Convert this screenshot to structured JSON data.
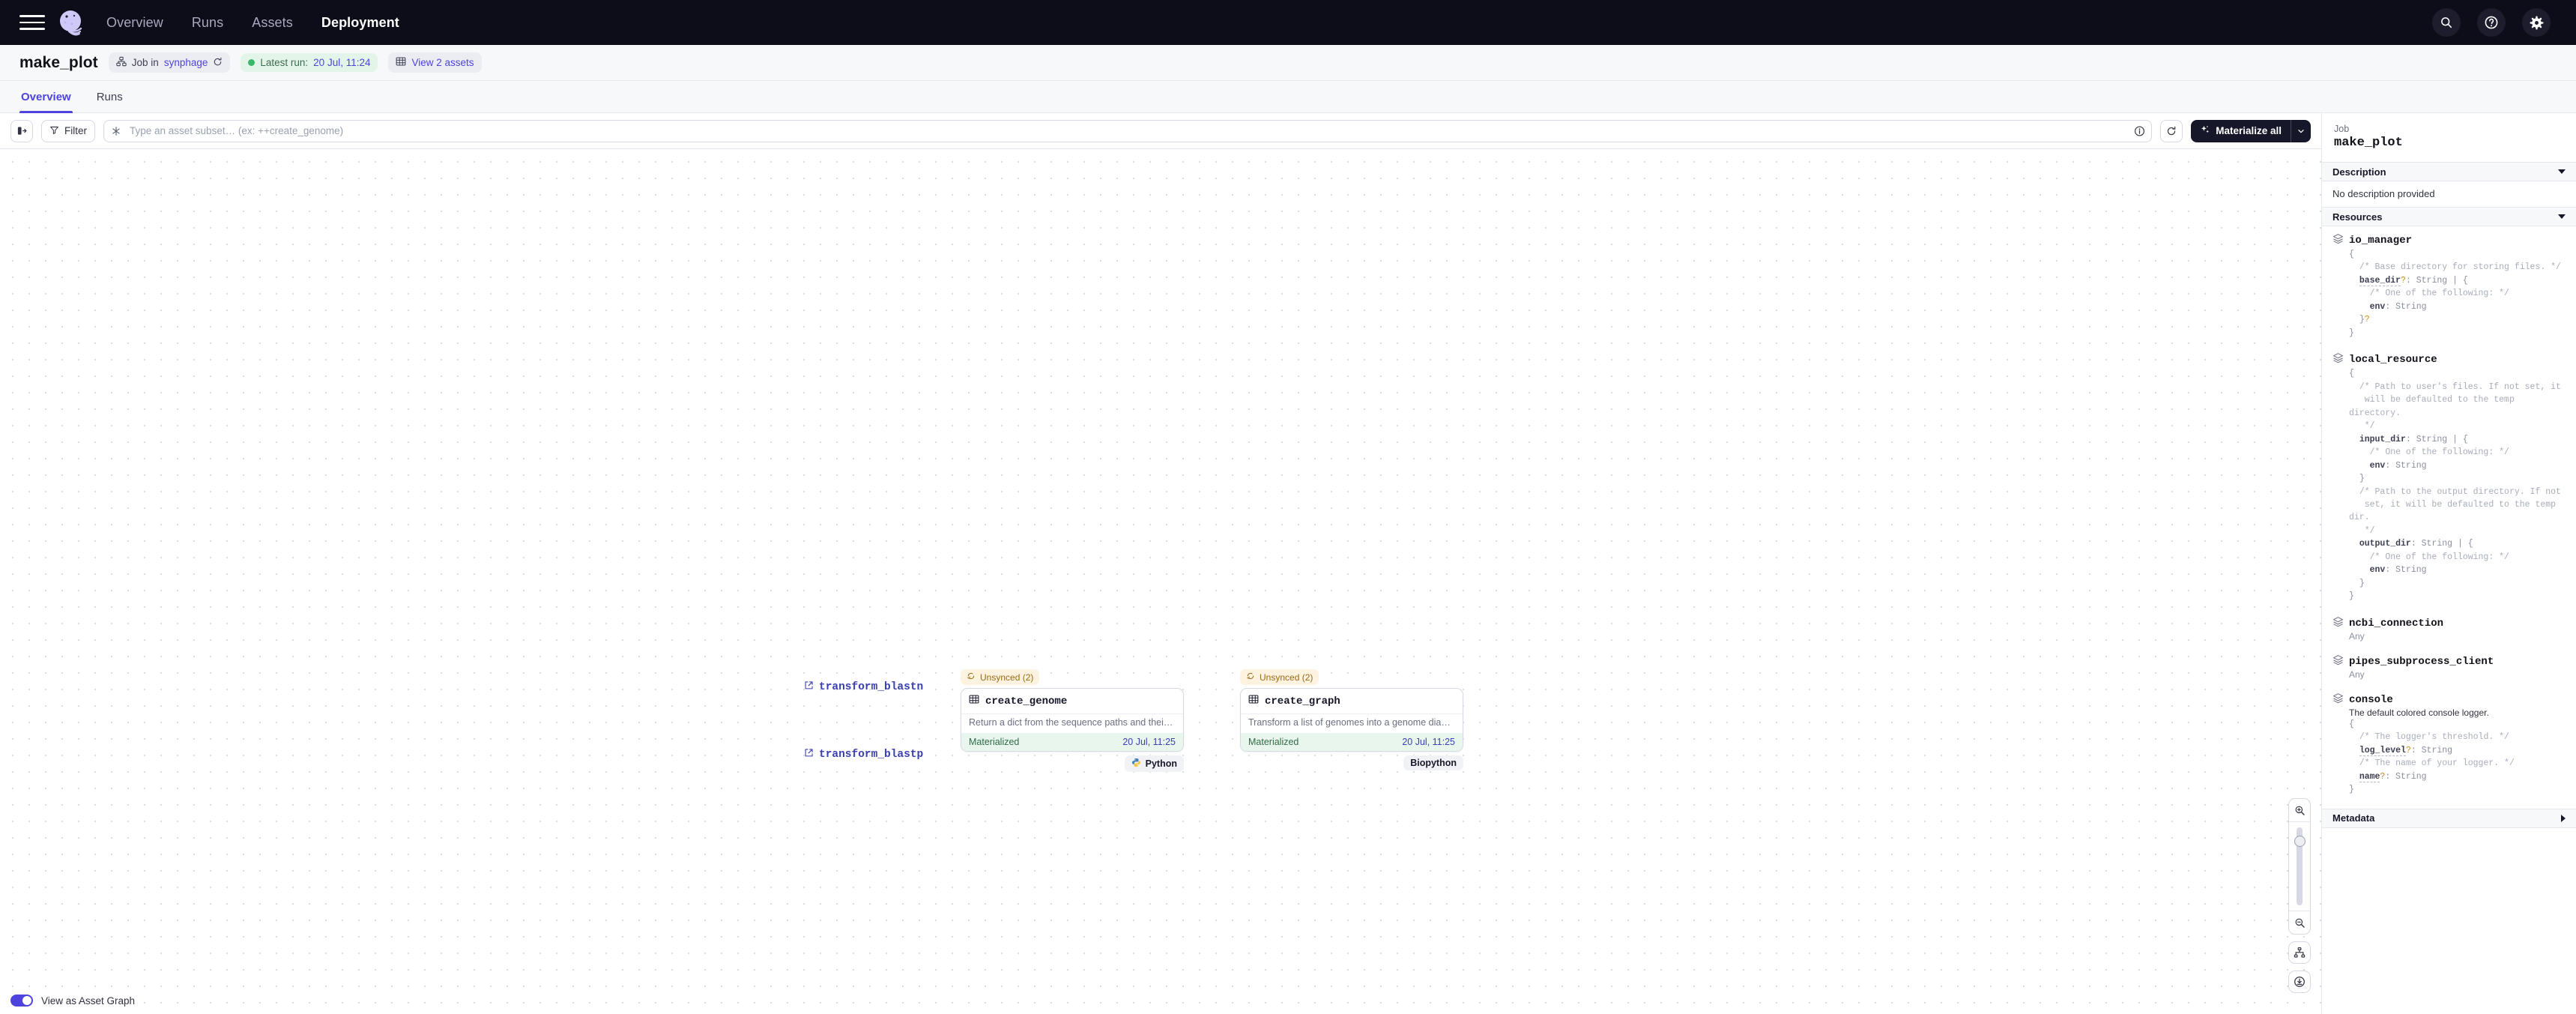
{
  "topnav": {
    "links": [
      {
        "label": "Overview",
        "active": false
      },
      {
        "label": "Runs",
        "active": false
      },
      {
        "label": "Assets",
        "active": false
      },
      {
        "label": "Deployment",
        "active": true
      }
    ],
    "icons": [
      "search-icon",
      "help-icon",
      "gear-icon"
    ]
  },
  "header": {
    "title": "make_plot",
    "job_chip": {
      "prefix": "Job in",
      "location": "synphage",
      "refresh_icon": "refresh-icon"
    },
    "latest_run_chip": {
      "label": "Latest run:",
      "value": "20 Jul, 11:24"
    },
    "assets_chip": {
      "label": "View 2 assets"
    }
  },
  "tabs": [
    {
      "label": "Overview",
      "active": true
    },
    {
      "label": "Runs",
      "active": false
    }
  ],
  "toolbar": {
    "sidebar_toggle_icon": "panel-toggle-icon",
    "filter_label": "Filter",
    "search_placeholder": "Type an asset subset… (ex: ++create_genome)",
    "info_icon": "info-icon",
    "refresh_icon": "refresh-icon",
    "materialize_label": "Materialize all",
    "materialize_caret": "chevron-down-icon"
  },
  "graph": {
    "upstream_nodes": [
      {
        "label": "transform_blastn"
      },
      {
        "label": "transform_blastp"
      }
    ],
    "asset_nodes": [
      {
        "badge": "Unsynced (2)",
        "name": "create_genome",
        "description": "Return a dict from the sequence paths and their …",
        "status": "Materialized",
        "timestamp": "20 Jul, 11:25",
        "tag": "Python",
        "tag_icon": "python-icon"
      },
      {
        "badge": "Unsynced (2)",
        "name": "create_graph",
        "description": "Transform a list of genomes into a genome diagr…",
        "status": "Materialized",
        "timestamp": "20 Jul, 11:25",
        "tag": "Biopython",
        "tag_icon": null
      }
    ],
    "zoom_controls": [
      "zoom-in-icon",
      "zoom-slider",
      "zoom-out-icon",
      "layout-icon",
      "download-icon"
    ],
    "bottom_toggle": {
      "label": "View as Asset Graph",
      "on": true
    }
  },
  "right_panel": {
    "kicker": "Job",
    "name": "make_plot",
    "sections": {
      "description": {
        "title": "Description",
        "expanded": true,
        "body": "No description provided"
      },
      "resources": {
        "title": "Resources",
        "expanded": true
      },
      "metadata": {
        "title": "Metadata",
        "expanded": false
      }
    },
    "resources": [
      {
        "name": "io_manager",
        "sub": null,
        "desc": null,
        "code": "{\n  /* Base directory for storing files. */\n  base_dir?: String | {\n    /* One of the following: */\n    env: String\n  }?\n}"
      },
      {
        "name": "local_resource",
        "sub": null,
        "desc": null,
        "code": "{\n  /* Path to user's files. If not set, it\n   will be defaulted to the temp directory.\n   */\n  input_dir: String | {\n    /* One of the following: */\n    env: String\n  }\n  /* Path to the output directory. If not\n   set, it will be defaulted to the temp dir.\n   */\n  output_dir: String | {\n    /* One of the following: */\n    env: String\n  }\n}"
      },
      {
        "name": "ncbi_connection",
        "sub": "Any",
        "desc": null,
        "code": null
      },
      {
        "name": "pipes_subprocess_client",
        "sub": "Any",
        "desc": null,
        "code": null
      },
      {
        "name": "console",
        "sub": null,
        "desc": "The default colored console logger.",
        "code": "{\n  /* The logger's threshold. */\n  log_level?: String\n  /* The name of your logger. */\n  name?: String\n}"
      }
    ]
  },
  "colors": {
    "accent": "#4f43dd",
    "nav_bg": "#0d0d1a",
    "success": "#3bb76c",
    "warning_bg": "#fdf3e0",
    "materialized_bg": "#e9f6ee"
  }
}
